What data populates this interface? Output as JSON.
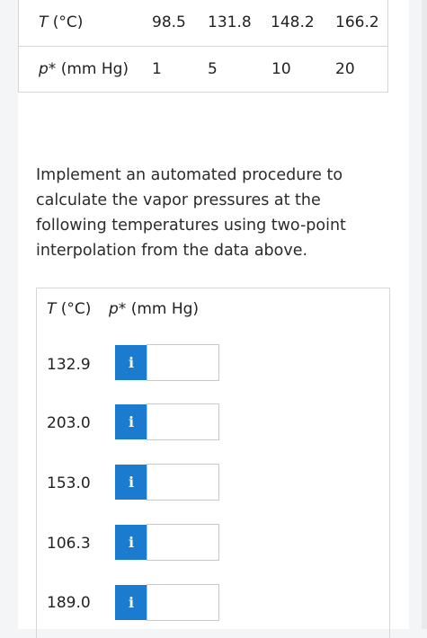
{
  "data_table": {
    "temp_header_sym": "T",
    "temp_header_unit": " (°C)",
    "temps": [
      "98.5",
      "131.8",
      "148.2",
      "166.2"
    ],
    "press_header_sym": "p*",
    "press_header_unit": " (mm Hg)",
    "pressures": [
      "1",
      "5",
      "10",
      "20"
    ]
  },
  "prompt": "Implement an automated procedure to calculate the vapor pressures at the following temperatures using two-point interpolation from the data above.",
  "answer_table": {
    "temp_header_sym": "T",
    "temp_header_unit": " (°C)",
    "press_header_sym": "p*",
    "press_header_unit": " (mm Hg)",
    "info_label": "i",
    "rows": [
      {
        "temp": "132.9",
        "value": ""
      },
      {
        "temp": "203.0",
        "value": ""
      },
      {
        "temp": "153.0",
        "value": ""
      },
      {
        "temp": "106.3",
        "value": ""
      },
      {
        "temp": "189.0",
        "value": ""
      }
    ]
  }
}
